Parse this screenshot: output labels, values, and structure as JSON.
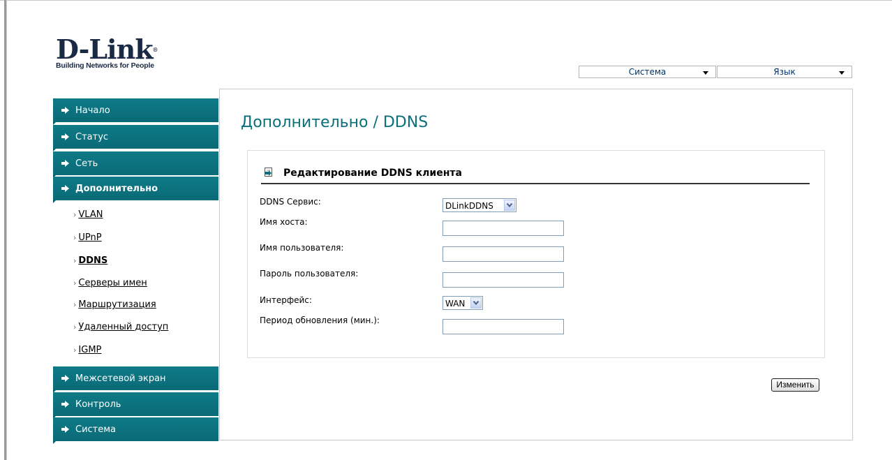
{
  "logo": {
    "brand": "D-Link",
    "registered": "®",
    "tagline": "Building Networks for People"
  },
  "top_menus": {
    "system": "Система",
    "language": "Язык"
  },
  "sidebar": {
    "items": [
      {
        "label": "Начало"
      },
      {
        "label": "Статус"
      },
      {
        "label": "Сеть"
      },
      {
        "label": "Дополнительно"
      },
      {
        "label": "Межсетевой экран"
      },
      {
        "label": "Контроль"
      },
      {
        "label": "Система"
      }
    ],
    "subitems": [
      {
        "label": "VLAN"
      },
      {
        "label": "UPnP"
      },
      {
        "label": "DDNS"
      },
      {
        "label": "Серверы имен"
      },
      {
        "label": "Маршрутизация"
      },
      {
        "label": "Удаленный доступ"
      },
      {
        "label": "IGMP"
      }
    ]
  },
  "main": {
    "title": "Дополнительно /  DDNS",
    "panel_title": "Редактирование DDNS клиента",
    "fields": {
      "ddns_service": {
        "label": "DDNS Сервис:",
        "value": "DLinkDDNS"
      },
      "hostname": {
        "label": "Имя хоста:",
        "value": ""
      },
      "username": {
        "label": "Имя пользователя:",
        "value": ""
      },
      "password": {
        "label": "Пароль пользователя:",
        "value": ""
      },
      "interface": {
        "label": "Интерфейс:",
        "value": "WAN"
      },
      "update_period": {
        "label": "Период обновления (мин.):",
        "value": ""
      }
    },
    "save_label": "Изменить"
  },
  "colors": {
    "accent": "#0a6f7a",
    "menu_bg": "#0f7a87"
  }
}
